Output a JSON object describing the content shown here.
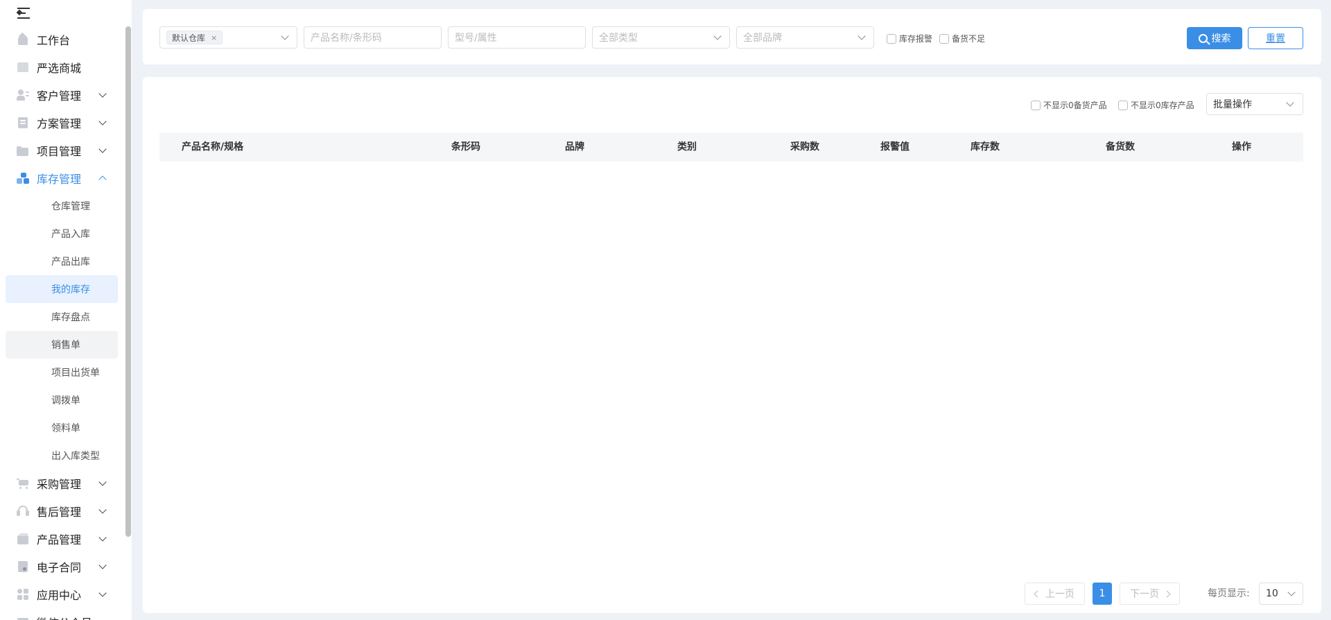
{
  "sidebar": {
    "items": [
      {
        "label": "工作台",
        "icon": "home-icon"
      },
      {
        "label": "严选商城",
        "icon": "mall-icon"
      },
      {
        "label": "客户管理",
        "icon": "customer-icon"
      },
      {
        "label": "方案管理",
        "icon": "plan-icon"
      },
      {
        "label": "项目管理",
        "icon": "folder-icon"
      },
      {
        "label": "库存管理",
        "icon": "inventory-icon"
      },
      {
        "label": "采购管理",
        "icon": "cart-icon"
      },
      {
        "label": "售后管理",
        "icon": "headset-icon"
      },
      {
        "label": "产品管理",
        "icon": "product-icon"
      },
      {
        "label": "电子合同",
        "icon": "contract-icon"
      },
      {
        "label": "应用中心",
        "icon": "apps-icon"
      },
      {
        "label": "微信公众号",
        "icon": "wechat-icon"
      }
    ],
    "inventory_sub": [
      "仓库管理",
      "产品入库",
      "产品出库",
      "我的库存",
      "库存盘点",
      "销售单",
      "项目出货单",
      "调拨单",
      "领料单",
      "出入库类型"
    ]
  },
  "filters": {
    "warehouse_tag": "默认仓库",
    "tag_close": "×",
    "product_placeholder": "产品名称/条形码",
    "model_placeholder": "型号/属性",
    "type_placeholder": "全部类型",
    "brand_placeholder": "全部品牌",
    "stock_alert": "库存报警",
    "prep_short": "备货不足",
    "search": "搜索",
    "reset": "重置"
  },
  "table": {
    "hide_zero_prep": "不显示0备货产品",
    "hide_zero_stock": "不显示0库存产品",
    "batch": "批量操作",
    "columns": [
      "产品名称/规格",
      "条形码",
      "品牌",
      "类别",
      "采购数",
      "报警值",
      "库存数",
      "备货数",
      "操作"
    ]
  },
  "pagination": {
    "prev": "上一页",
    "current": "1",
    "next": "下一页",
    "per_page_label": "每页显示:",
    "per_page_value": "10"
  },
  "colors": {
    "accent": "#3a8ee6",
    "active_bg": "#e8f1fd"
  }
}
